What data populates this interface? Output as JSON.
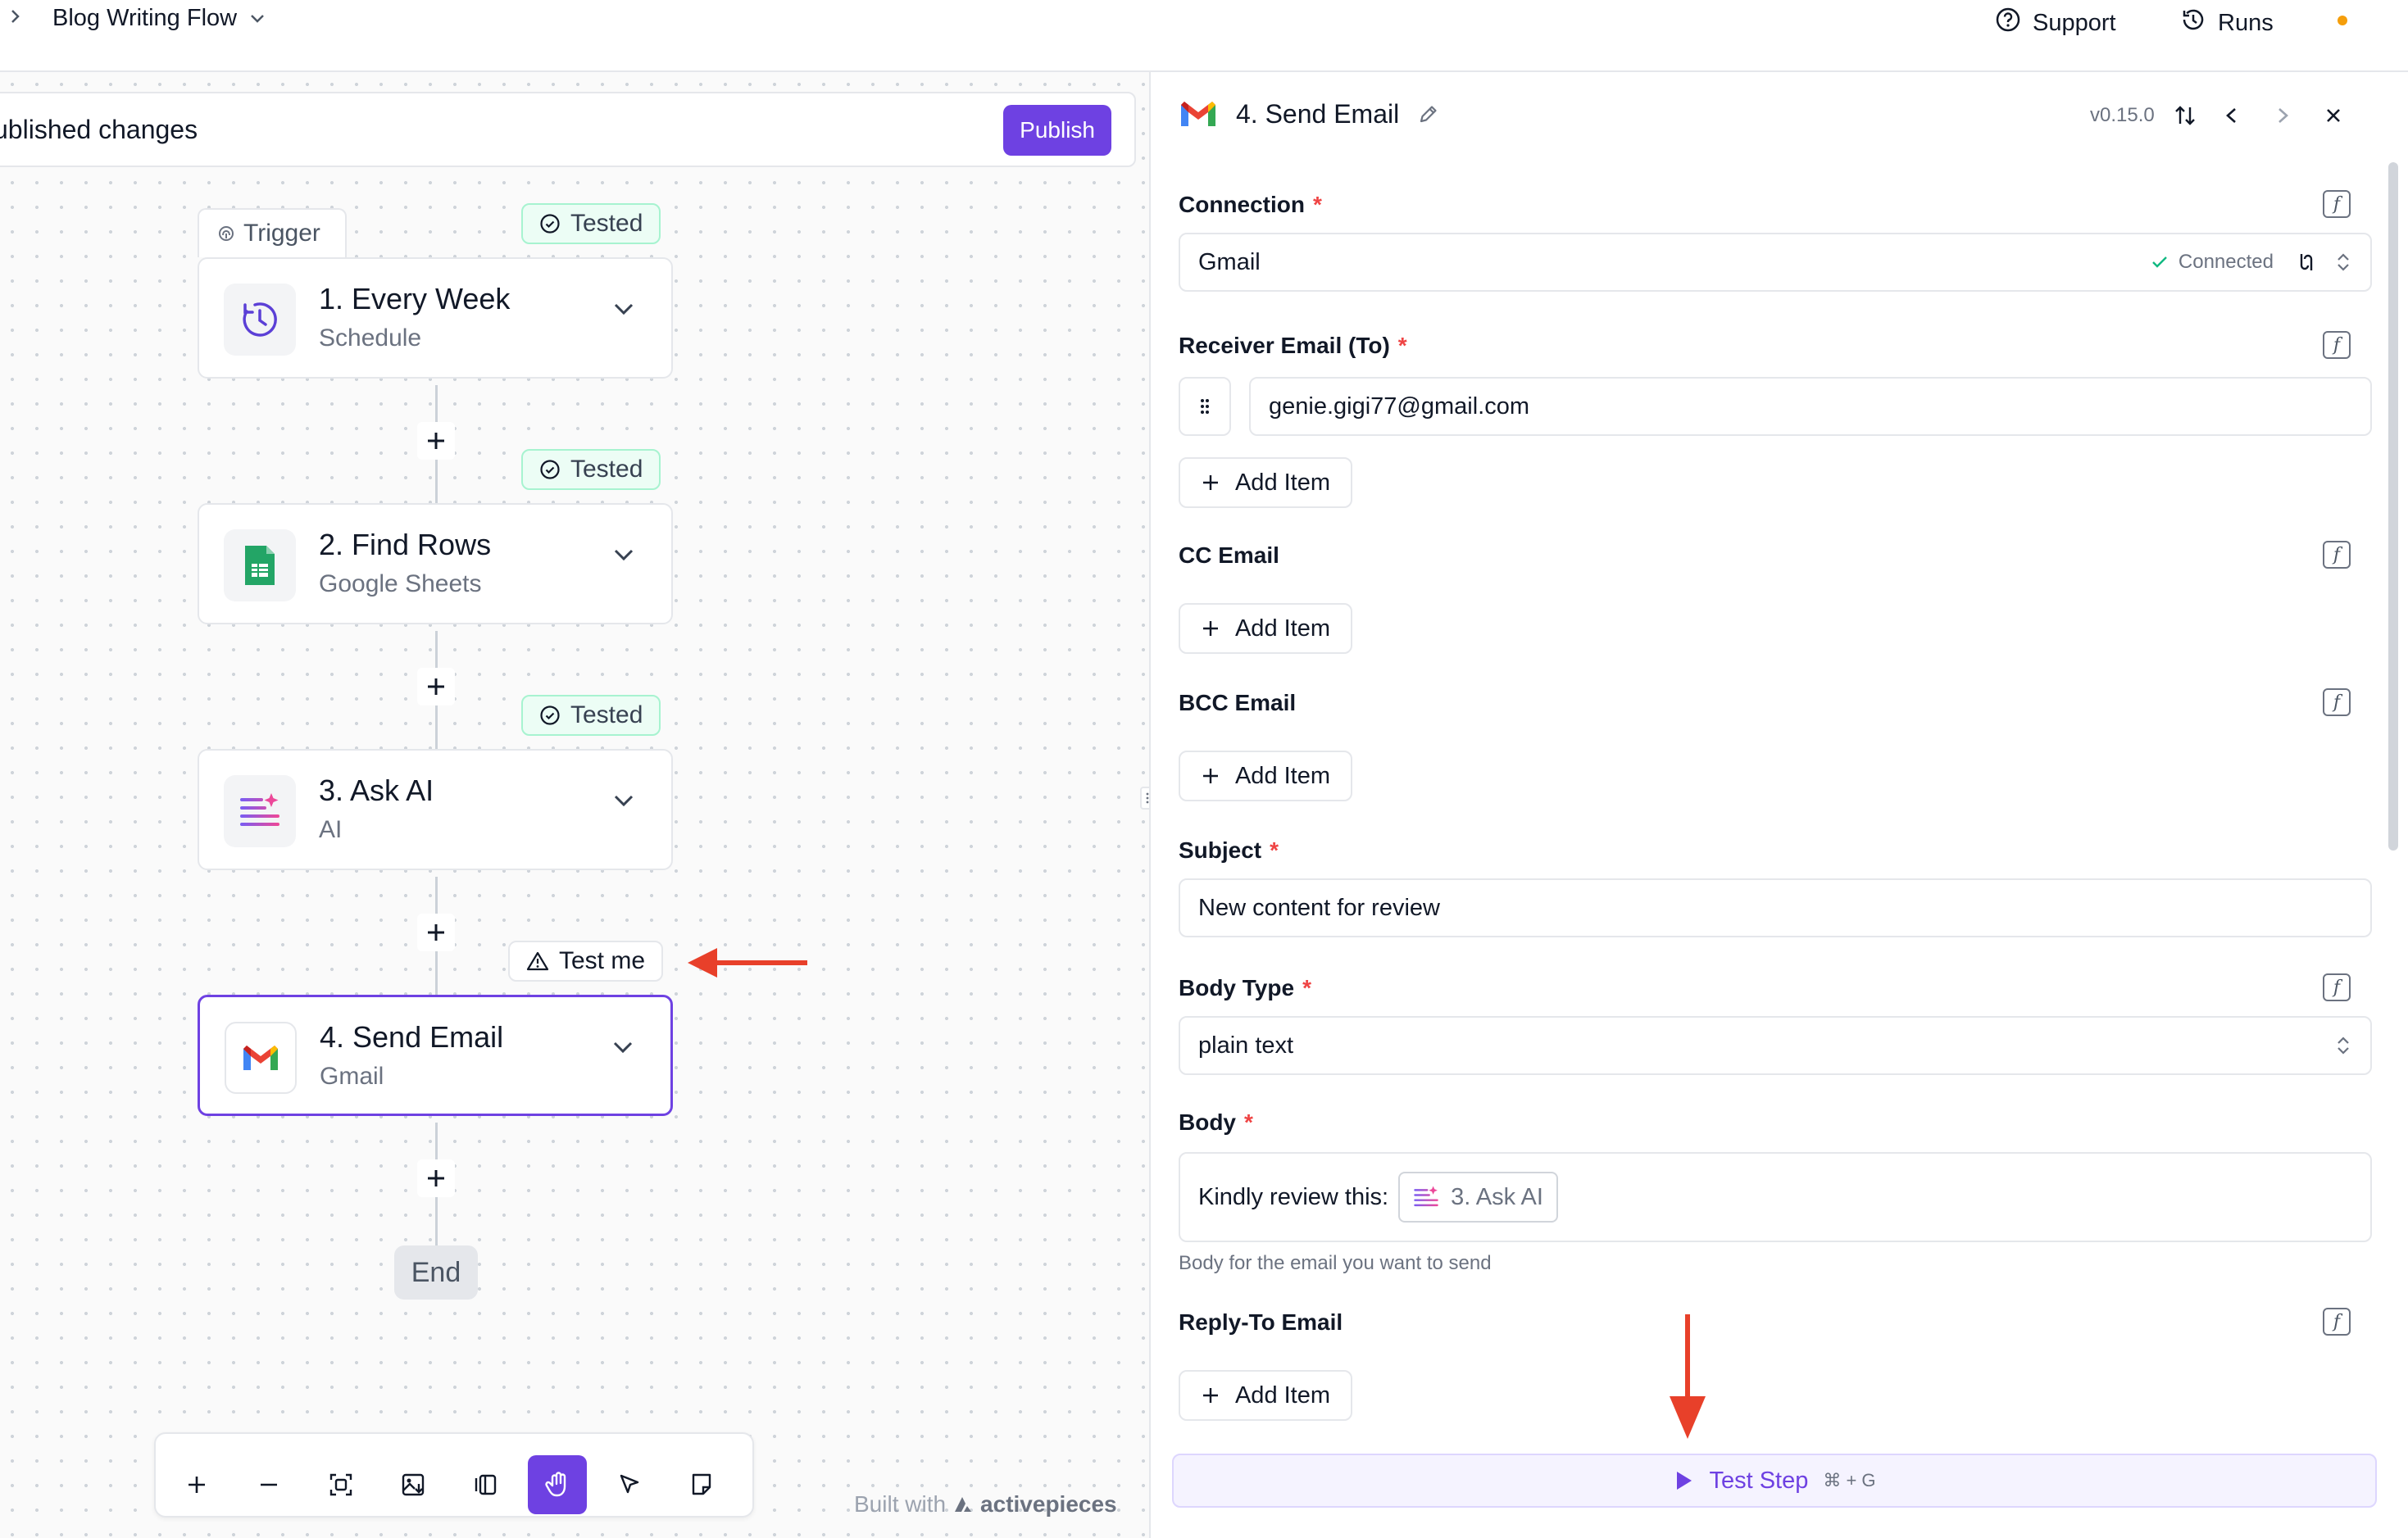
{
  "topbar": {
    "flow_name": "Blog Writing Flow",
    "support_label": "Support",
    "runs_label": "Runs"
  },
  "canvas": {
    "unpublished_text": "ublished changes",
    "publish_label": "Publish",
    "trigger_tag": "Trigger",
    "nodes": [
      {
        "title": "1. Every Week",
        "subtitle": "Schedule",
        "status": "Tested"
      },
      {
        "title": "2. Find Rows",
        "subtitle": "Google Sheets",
        "status": "Tested"
      },
      {
        "title": "3. Ask AI",
        "subtitle": "AI",
        "status": "Tested"
      },
      {
        "title": "4. Send Email",
        "subtitle": "Gmail",
        "status": "Test me"
      }
    ],
    "end_label": "End",
    "built_with": "Built with",
    "brand": "activepieces"
  },
  "panel": {
    "title": "4. Send Email",
    "version": "v0.15.0",
    "connection": {
      "label": "Connection",
      "value": "Gmail",
      "status": "Connected"
    },
    "receiver": {
      "label": "Receiver Email (To)",
      "value": "genie.gigi77@gmail.com",
      "add_label": "Add Item"
    },
    "cc": {
      "label": "CC Email",
      "add_label": "Add Item"
    },
    "bcc": {
      "label": "BCC Email",
      "add_label": "Add Item"
    },
    "subject": {
      "label": "Subject",
      "value": "New content for review"
    },
    "body_type": {
      "label": "Body Type",
      "value": "plain text"
    },
    "body": {
      "label": "Body",
      "prefix": "Kindly review this:",
      "chip": "3. Ask AI",
      "help": "Body for the email you want to send"
    },
    "reply_to": {
      "label": "Reply-To Email",
      "add_label": "Add Item"
    },
    "test_step": {
      "label": "Test Step",
      "shortcut": "⌘ + G"
    }
  },
  "colors": {
    "accent": "#6e41e2",
    "tested_bg": "#ecfdf5",
    "required": "#ef4444",
    "annotation_arrow": "#e8402a"
  }
}
